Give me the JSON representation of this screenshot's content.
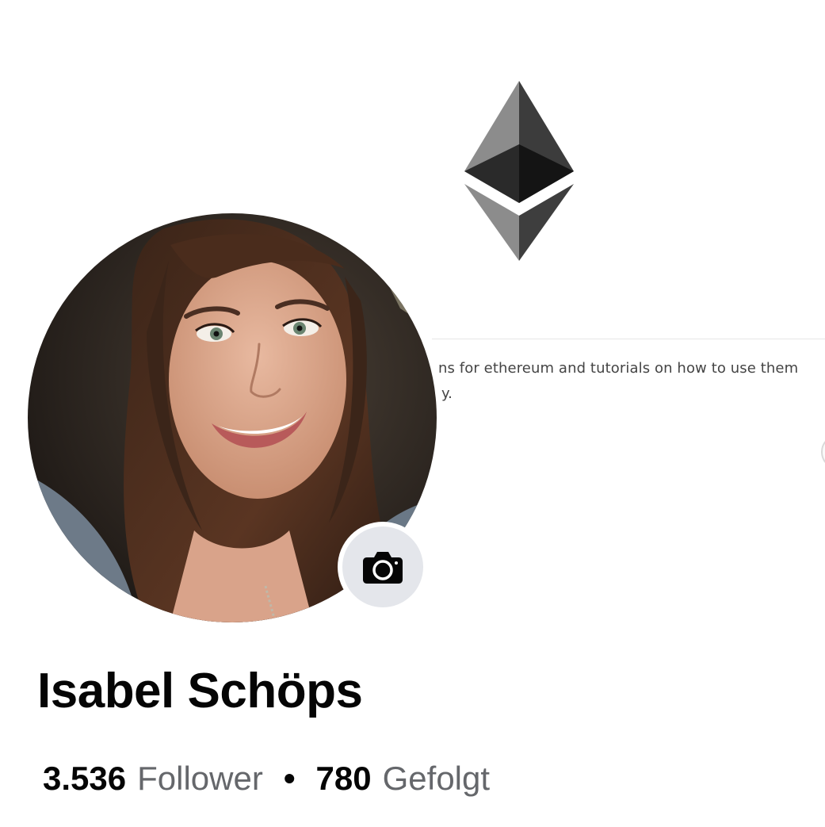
{
  "cover": {
    "logo_icon": "ethereum-logo-icon",
    "text_line1": "ns for ethereum and tutorials on how to use them",
    "text_line2": "y."
  },
  "profile": {
    "name": "Isabel Schöps",
    "avatar": "profile-photo",
    "camera_icon": "camera-icon"
  },
  "stats": {
    "followers_count": "3.536",
    "followers_label": "Follower",
    "separator": "•",
    "following_count": "780",
    "following_label": "Gefolgt"
  },
  "colors": {
    "name_text": "#050505",
    "secondary_text": "#65676b",
    "camera_button_bg": "#e4e6eb"
  }
}
